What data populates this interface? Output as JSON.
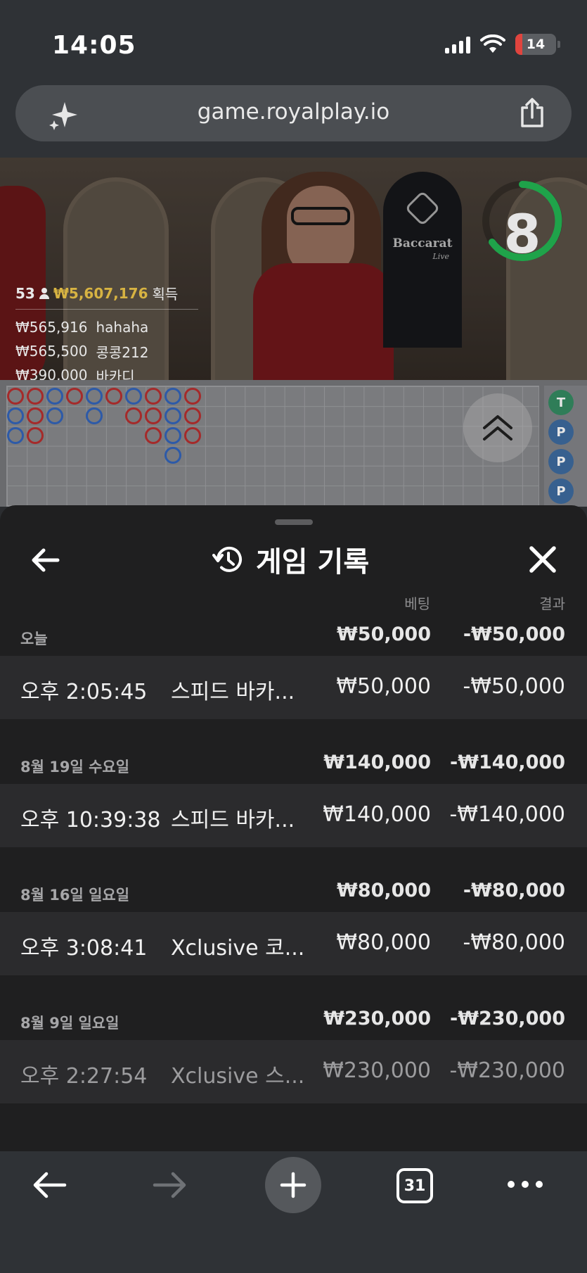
{
  "status": {
    "time": "14:05",
    "battery": "14"
  },
  "browser": {
    "url": "game.royalplay.io",
    "tabs_count": "31"
  },
  "video": {
    "brand": "Baccarat",
    "brand_sub": "Live",
    "countdown": "8",
    "winners_count": "53",
    "winners_total": "₩5,607,176",
    "winners_suffix": "획득",
    "winners": [
      {
        "amount": "₩565,916",
        "name": "hahaha"
      },
      {
        "amount": "₩565,500",
        "name": "콩콩212"
      },
      {
        "amount": "₩390,000",
        "name": "바카디"
      }
    ]
  },
  "roadmap_side": [
    "T",
    "P",
    "P",
    "P"
  ],
  "sheet": {
    "title": "게임 기록",
    "col_bet": "베팅",
    "col_result": "결과",
    "groups": [
      {
        "date": "오늘",
        "bet": "₩50,000",
        "result": "-₩50,000",
        "rows": [
          {
            "time": "오후 2:05:45",
            "game": "스피드 바카...",
            "bet": "₩50,000",
            "result": "-₩50,000"
          }
        ]
      },
      {
        "date": "8월 19일 수요일",
        "bet": "₩140,000",
        "result": "-₩140,000",
        "rows": [
          {
            "time": "오후 10:39:38",
            "game": "스피드 바카...",
            "bet": "₩140,000",
            "result": "-₩140,000"
          }
        ]
      },
      {
        "date": "8월 16일 일요일",
        "bet": "₩80,000",
        "result": "-₩80,000",
        "rows": [
          {
            "time": "오후 3:08:41",
            "game": "Xclusive 코...",
            "bet": "₩80,000",
            "result": "-₩80,000"
          }
        ]
      },
      {
        "date": "8월 9일 일요일",
        "bet": "₩230,000",
        "result": "-₩230,000",
        "rows": [
          {
            "time": "오후 2:27:54",
            "game": "Xclusive 스...",
            "bet": "₩230,000",
            "result": "-₩230,000"
          }
        ]
      }
    ]
  },
  "colors": {
    "accent_green": "#1fa34a",
    "gold": "#d7b342",
    "player_blue": "#2d5aa8",
    "banker_red": "#a52a2a"
  }
}
